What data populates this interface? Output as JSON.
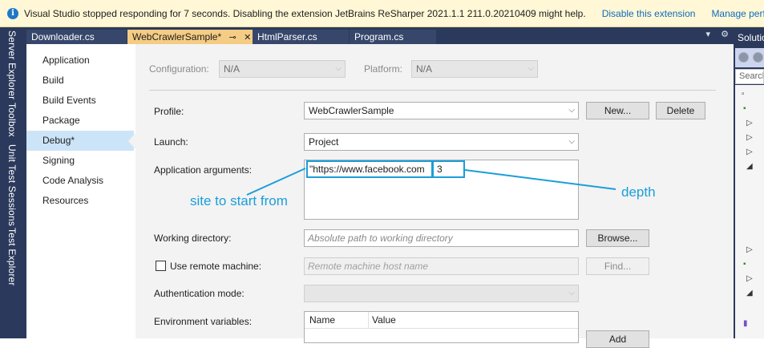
{
  "infobar": {
    "message": "Visual Studio stopped responding for 7 seconds. Disabling the extension JetBrains ReSharper 2021.1.1 211.0.20210409 might help.",
    "action1": "Disable this extension",
    "action2": "Manage performance"
  },
  "rail": {
    "items": [
      "Server Explorer",
      "Toolbox",
      "Unit Test Sessions",
      "Test Explorer"
    ]
  },
  "tabs": [
    {
      "label": "Downloader.cs",
      "active": false
    },
    {
      "label": "WebCrawlerSample*",
      "active": true
    },
    {
      "label": "HtmlParser.cs",
      "active": false
    },
    {
      "label": "Program.cs",
      "active": false
    }
  ],
  "solution": {
    "title": "Solution",
    "search_placeholder": "Search"
  },
  "nav": {
    "items": [
      "Application",
      "Build",
      "Build Events",
      "Package",
      "Debug*",
      "Signing",
      "Code Analysis",
      "Resources"
    ],
    "selected_index": 4
  },
  "config": {
    "configuration_label": "Configuration:",
    "configuration_value": "N/A",
    "platform_label": "Platform:",
    "platform_value": "N/A"
  },
  "form": {
    "profile_label": "Profile:",
    "profile_value": "WebCrawlerSample",
    "new_button": "New...",
    "delete_button": "Delete",
    "launch_label": "Launch:",
    "launch_value": "Project",
    "args_label": "Application arguments:",
    "args_url": "\"https://www.facebook.com",
    "args_depth": "3",
    "workdir_label": "Working directory:",
    "workdir_placeholder": "Absolute path to working directory",
    "browse_button": "Browse...",
    "remote_label": "Use remote machine:",
    "remote_placeholder": "Remote machine host name",
    "find_button": "Find...",
    "auth_label": "Authentication mode:",
    "env_label": "Environment variables:",
    "env_col_name": "Name",
    "env_col_value": "Value",
    "add_button": "Add"
  },
  "annotations": {
    "site_label": "site to start from",
    "depth_label": "depth",
    "color": "#1a9ed9"
  },
  "colors": {
    "chrome": "#2b3a5c",
    "active_tab": "#f5cc84",
    "infobar": "#fff7d6",
    "nav_selected": "#cce4f7"
  }
}
